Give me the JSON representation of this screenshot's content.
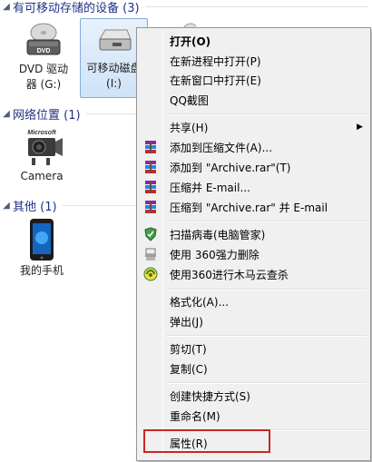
{
  "groups": {
    "removable": {
      "title": "有可移动存储的设备 (3)"
    },
    "network": {
      "title": "网络位置 (1)"
    },
    "other": {
      "title": "其他 (1)"
    }
  },
  "devices": {
    "dvd": {
      "line1": "DVD 驱动",
      "line2": "器 (G:)",
      "badge": "DVD"
    },
    "removable": {
      "line1": "可移动磁盘",
      "line2": "(I:)"
    },
    "camera": {
      "label": "Camera",
      "brand": "Microsoft"
    },
    "phone": {
      "label": "我的手机"
    }
  },
  "menu": {
    "items": [
      {
        "label": "打开(O)",
        "bold": true
      },
      {
        "label": "在新进程中打开(P)"
      },
      {
        "label": "在新窗口中打开(E)"
      },
      {
        "label": "QQ截图"
      },
      {
        "label": "共享(H)",
        "submenu": true
      },
      {
        "label": "添加到压缩文件(A)...",
        "icon": "winrar-icon"
      },
      {
        "label": "添加到 \"Archive.rar\"(T)",
        "icon": "winrar-icon"
      },
      {
        "label": "压缩并 E-mail...",
        "icon": "winrar-icon"
      },
      {
        "label": "压缩到 \"Archive.rar\" 并 E-mail",
        "icon": "winrar-icon"
      },
      {
        "label": "扫描病毒(电脑管家)",
        "icon": "shield-icon"
      },
      {
        "label": "使用 360强力删除",
        "icon": "shredder-icon"
      },
      {
        "label": "使用360进行木马云查杀",
        "icon": "360-scan-icon"
      },
      {
        "label": "格式化(A)..."
      },
      {
        "label": "弹出(J)"
      },
      {
        "label": "剪切(T)"
      },
      {
        "label": "复制(C)"
      },
      {
        "label": "创建快捷方式(S)"
      },
      {
        "label": "重命名(M)"
      },
      {
        "label": "属性(R)"
      }
    ],
    "submenu_arrow": "▶"
  },
  "colors": {
    "menu_bg": "#f0f0f0",
    "group_header": "#1e3287",
    "highlight": "#c62828"
  }
}
